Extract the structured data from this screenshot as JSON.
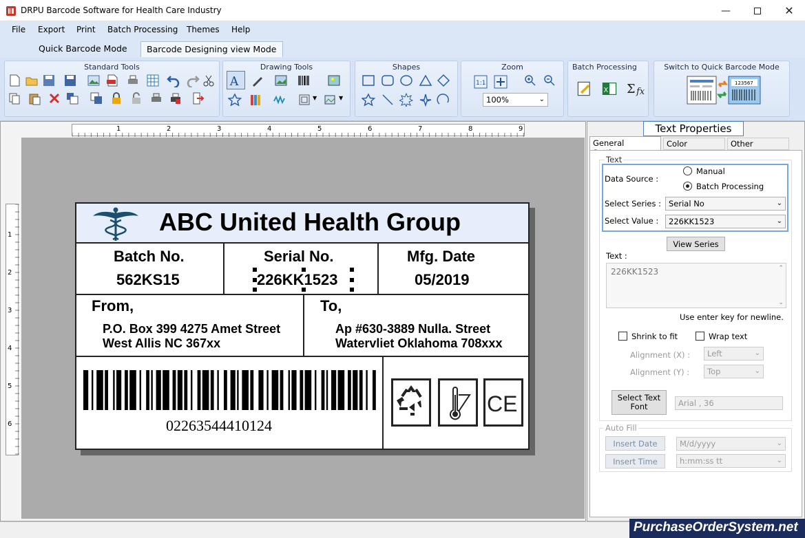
{
  "window": {
    "title": "DRPU Barcode Software for Health Care Industry",
    "minimize_icon": "minimize-icon",
    "maximize_icon": "maximize-icon",
    "close_icon": "close-icon"
  },
  "menu": [
    "File",
    "Export",
    "Print",
    "Batch Processing",
    "Themes",
    "Help"
  ],
  "mode_tabs": [
    {
      "label": "Quick Barcode Mode",
      "active": false
    },
    {
      "label": "Barcode Designing view Mode",
      "active": true
    }
  ],
  "ribbon": {
    "standard_tools": {
      "title": "Standard Tools"
    },
    "drawing_tools": {
      "title": "Drawing Tools"
    },
    "shapes": {
      "title": "Shapes"
    },
    "zoom": {
      "title": "Zoom",
      "value": "100%"
    },
    "batch_processing": {
      "title": "Batch Processing"
    },
    "switch": {
      "title": "Switch to Quick Barcode Mode",
      "icon_text": "123567"
    }
  },
  "ruler": {
    "h": [
      "1",
      "2",
      "3",
      "4",
      "5",
      "6",
      "7",
      "8",
      "9"
    ],
    "v": [
      "1",
      "2",
      "3",
      "4",
      "5",
      "6"
    ]
  },
  "label": {
    "company": "ABC United Health Group",
    "batch_title": "Batch No.",
    "batch_value": "562KS15",
    "serial_title": "Serial No.",
    "serial_value": "226KK1523",
    "mfg_title": "Mfg. Date",
    "mfg_value": "05/2019",
    "from_title": "From,",
    "from_line1": "P.O. Box 399 4275 Amet Street",
    "from_line2": "West Allis NC 367xx",
    "to_title": "To,",
    "to_line1": "Ap #630-3889 Nulla. Street",
    "to_line2": "Watervliet Oklahoma 708xxx",
    "barcode_number": "02263544410124",
    "symbols": [
      "recycle-icon",
      "temperature-icon",
      "ce-mark-icon"
    ],
    "ce_text": "CE"
  },
  "properties": {
    "title": "Text Properties",
    "tabs": [
      "General Settings",
      "Color Settings",
      "Other Settings"
    ],
    "text_group": "Text",
    "data_source_label": "Data Source :",
    "manual": "Manual",
    "batch_processing": "Batch Processing",
    "select_series_label": "Select Series :",
    "select_series_value": "Serial No",
    "select_value_label": "Select Value :",
    "select_value_value": "226KK1523",
    "view_series": "View Series",
    "text_label": "Text :",
    "text_value": "226KK1523",
    "newline_hint": "Use enter key for newline.",
    "shrink_to_fit": "Shrink to fit",
    "wrap_text": "Wrap text",
    "align_x_label": "Alignment (X) :",
    "align_x_value": "Left",
    "align_y_label": "Alignment (Y) :",
    "align_y_value": "Top",
    "select_font_line1": "Select Text",
    "select_font_line2": "Font",
    "font_value": "Arial , 36",
    "auto_fill": "Auto Fill",
    "insert_date": "Insert Date",
    "date_format": "M/d/yyyy",
    "insert_time": "Insert Time",
    "time_format": "h:mm:ss tt"
  },
  "watermark": "PurchaseOrderSystem.net",
  "colors": {
    "accent": "#dbe6f6",
    "label_header": "#e6eefc",
    "watermark_bg": "#1a2b5c"
  }
}
